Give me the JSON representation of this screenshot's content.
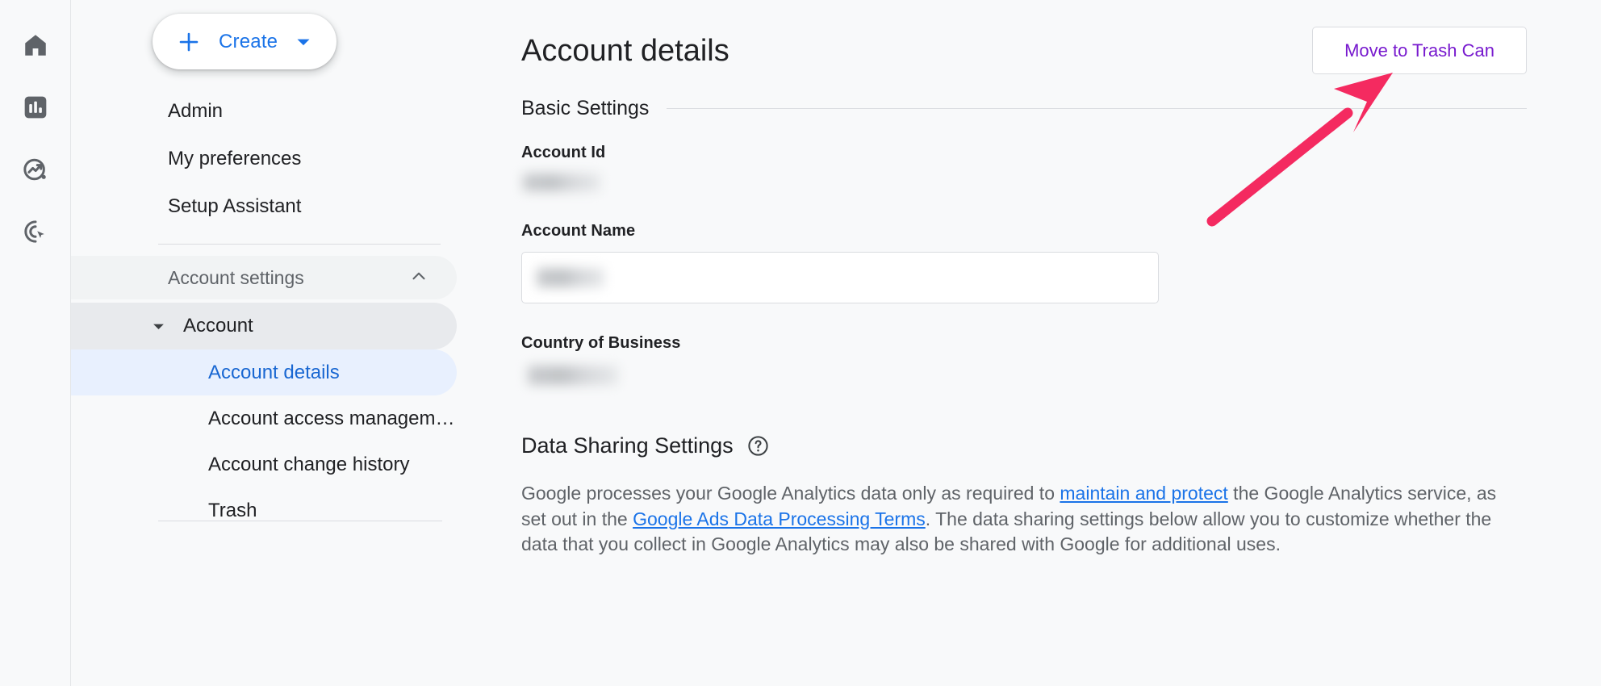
{
  "rail": {
    "items": [
      {
        "name": "home-icon",
        "label": "Home"
      },
      {
        "name": "reports-icon",
        "label": "Reports"
      },
      {
        "name": "explore-icon",
        "label": "Explore"
      },
      {
        "name": "advertising-icon",
        "label": "Advertising"
      }
    ]
  },
  "sidebar": {
    "create_button": {
      "label": "Create",
      "plus_icon": "plus-icon",
      "caret_icon": "chevron-down-icon"
    },
    "top_items": [
      {
        "label": "Admin"
      },
      {
        "label": "My preferences"
      },
      {
        "label": "Setup Assistant"
      }
    ],
    "account_settings": {
      "label": "Account settings",
      "chevron": "chevron-up-icon",
      "expanded": true
    },
    "account_group": {
      "label": "Account",
      "caret": "caret-down-icon",
      "expanded": true
    },
    "sub_items": [
      {
        "label": "Account details",
        "active": true
      },
      {
        "label": "Account access managem…",
        "active": false
      },
      {
        "label": "Account change history",
        "active": false
      },
      {
        "label": "Trash",
        "active": false
      }
    ]
  },
  "main": {
    "page_title": "Account details",
    "trash_button": {
      "label": "Move to Trash Can"
    },
    "basic_settings": {
      "label": "Basic Settings"
    },
    "fields": {
      "account_id": {
        "label": "Account Id",
        "value": "",
        "redacted": true
      },
      "account_name": {
        "label": "Account Name",
        "value": "",
        "redacted": true
      },
      "country_of_business": {
        "label": "Country of Business",
        "value": "",
        "redacted": true
      }
    },
    "data_sharing": {
      "title": "Data Sharing Settings",
      "help_icon": "help-circle-icon",
      "paragraph_part1": "Google processes your Google Analytics data only as required to ",
      "link1": "maintain and protect",
      "paragraph_part2": " the Google Analytics service, as set out in the ",
      "link2": "Google Ads Data Processing Terms",
      "paragraph_part3": ". The data sharing settings below allow you to customize whether the data that you collect in Google Analytics may also be shared with Google for additional uses."
    }
  },
  "annotation": {
    "arrow": {
      "name": "pink-arrow-annotation",
      "color": "#F42A60",
      "points_to": "Move to Trash Can"
    }
  },
  "colors": {
    "accent_blue": "#1A73E8",
    "active_nav_bg": "#E8F0FE",
    "active_nav_text": "#1967D2",
    "purple_link": "#7719CE",
    "page_bg": "#F8F9FA",
    "arrow_pink": "#F42A60"
  }
}
